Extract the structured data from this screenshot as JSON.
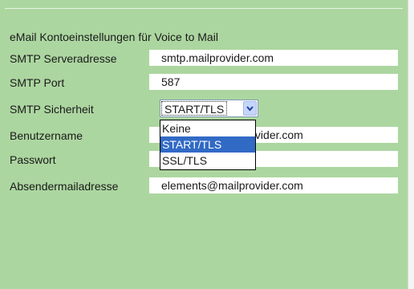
{
  "heading": "eMail Kontoeinstellungen für Voice to Mail",
  "labels": {
    "smtp_server": "SMTP Serveradresse",
    "smtp_port": "SMTP Port",
    "smtp_security": "SMTP Sicherheit",
    "username": "Benutzername",
    "password": "Passwort",
    "sender": "Absendermailadresse"
  },
  "values": {
    "smtp_server": "smtp.mailprovider.com",
    "smtp_port": "587",
    "smtp_security": "START/TLS",
    "username": "elements@mailprovider.com",
    "password": "",
    "sender": "elements@mailprovider.com"
  },
  "security_options": [
    "Keine",
    "START/TLS",
    "SSL/TLS"
  ],
  "selected_option_index": 1,
  "icons": {
    "select_arrow": "chevron-down-icon"
  },
  "colors": {
    "panel_bg": "#acd6a0",
    "selection": "#316ac5",
    "arrow_button": "#c6d6fb"
  }
}
